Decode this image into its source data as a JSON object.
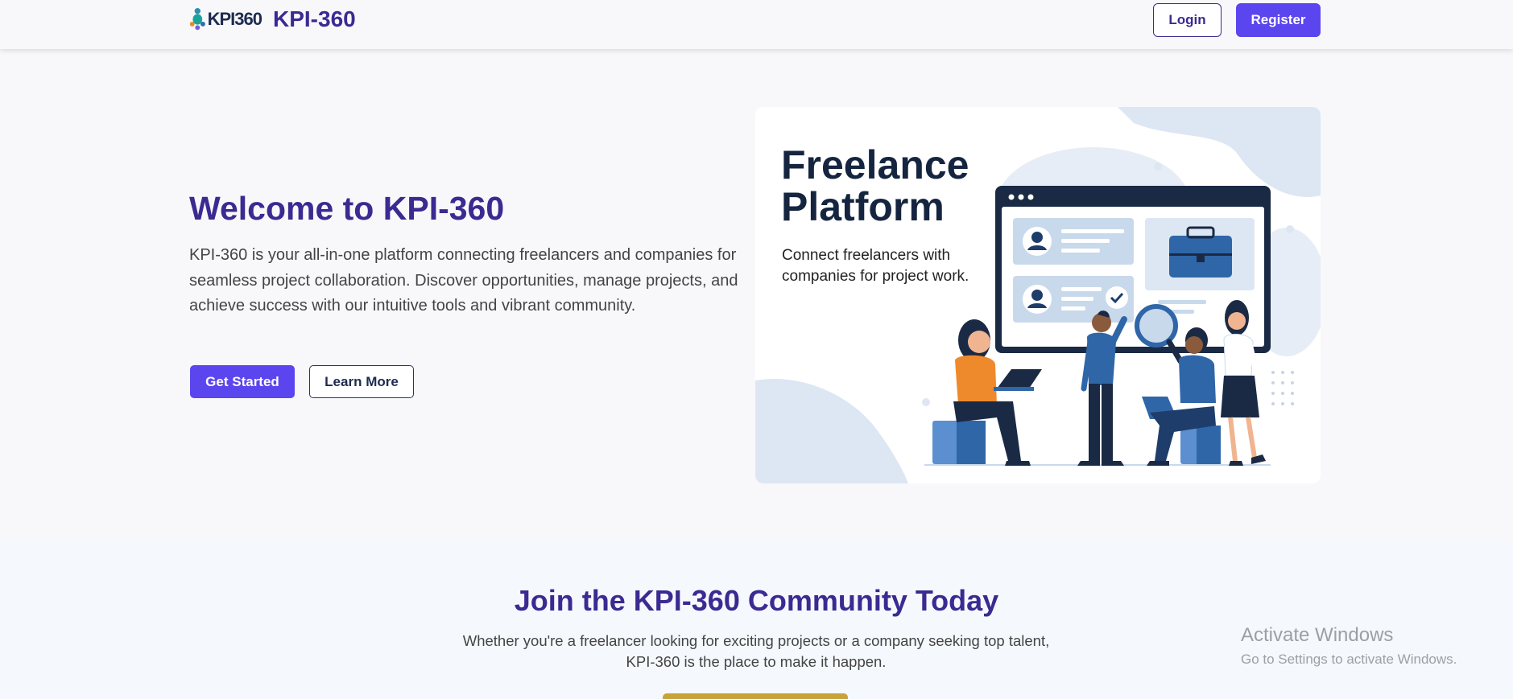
{
  "header": {
    "logo_text": "KPI360",
    "brand": "KPI-360",
    "login_label": "Login",
    "register_label": "Register"
  },
  "hero": {
    "title": "Welcome to KPI-360",
    "description": "KPI-360 is your all-in-one platform connecting freelancers and companies for seamless project collaboration. Discover opportunities, manage projects, and achieve success with our intuitive tools and vibrant community.",
    "get_started_label": "Get Started",
    "learn_more_label": "Learn More"
  },
  "illustration": {
    "title_line1": "Freelance",
    "title_line2": "Platform",
    "subtitle": "Connect freelancers with companies for project work."
  },
  "community": {
    "title": "Join the KPI-360 Community Today",
    "text": "Whether you're a freelancer looking for exciting projects or a company seeking top talent, KPI-360 is the place to make it happen."
  },
  "windows_watermark": {
    "line1": "Activate Windows",
    "line2": "Go to Settings to activate Windows."
  },
  "colors": {
    "primary": "#5b45ef",
    "heading": "#3b2a91",
    "navy": "#1d3a5f",
    "gold": "#c9a23a"
  }
}
